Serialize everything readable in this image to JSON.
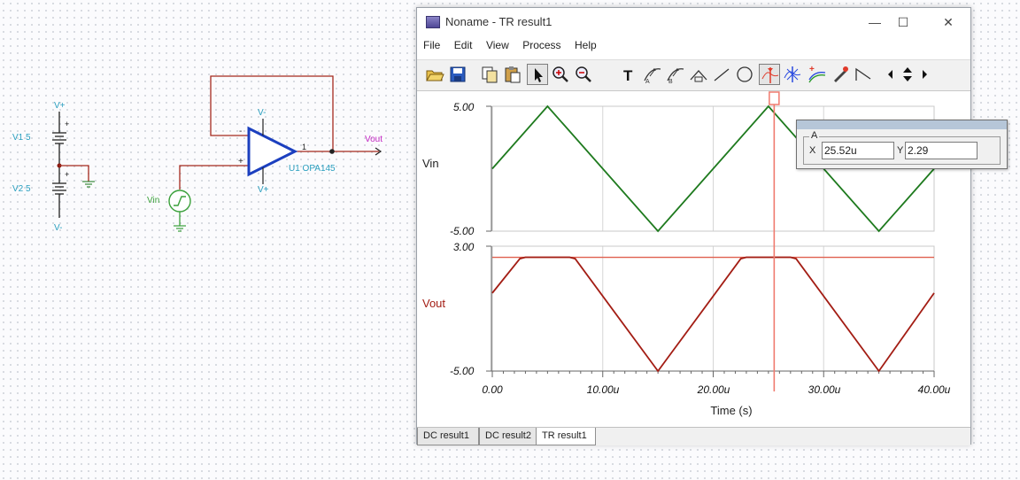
{
  "schematic": {
    "vplus_top": "V+",
    "v1_label": "V1 5",
    "v2_label": "V2 5",
    "vminus_bottom": "V-",
    "opamp_vminus": "V-",
    "opamp_vplus": "V+",
    "opamp_name": "U1 OPA145",
    "pin_neg": "-",
    "pin_pos": "+",
    "pin_out": "1",
    "vin_label": "Vin",
    "vout_label": "Vout"
  },
  "window": {
    "title": "Noname - TR result1",
    "minimize": "—",
    "maximize": "☐",
    "close": "✕"
  },
  "menu": [
    "File",
    "Edit",
    "View",
    "Process",
    "Help"
  ],
  "toolbar": [
    {
      "icon": "open-folder-icon",
      "pressed": false
    },
    {
      "icon": "save-icon",
      "pressed": false
    },
    {
      "icon": "copy-icon",
      "pressed": false
    },
    {
      "icon": "paste-icon",
      "pressed": false
    },
    {
      "icon": "select-arrow-icon",
      "pressed": true
    },
    {
      "icon": "zoom-in-icon",
      "pressed": false
    },
    {
      "icon": "zoom-out-icon",
      "pressed": false
    },
    {
      "icon": "text-tool-icon",
      "pressed": false
    },
    {
      "icon": "curve-marker-icon",
      "pressed": false
    },
    {
      "icon": "curve-marker-2-icon",
      "pressed": false
    },
    {
      "icon": "shape-marker-icon",
      "pressed": false
    },
    {
      "icon": "line-tool-icon",
      "pressed": false
    },
    {
      "icon": "ellipse-tool-icon",
      "pressed": false
    },
    {
      "icon": "cursor-a-icon",
      "pressed": true
    },
    {
      "icon": "cursor-b-icon",
      "pressed": false
    },
    {
      "icon": "add-cursor-icon",
      "pressed": false
    },
    {
      "icon": "pen-marker-icon",
      "pressed": false
    },
    {
      "icon": "step-icon",
      "pressed": false
    },
    {
      "icon": "nav-left-icon",
      "pressed": false
    },
    {
      "icon": "nav-updown-icon",
      "pressed": false
    },
    {
      "icon": "nav-right-icon",
      "pressed": false
    }
  ],
  "cursor_readout": {
    "group": "A",
    "x_label": "X",
    "x_value": "25.52u",
    "y_label": "Y",
    "y_value": "2.29"
  },
  "tabs": [
    {
      "label": "DC result1",
      "active": false
    },
    {
      "label": "DC result2",
      "active": false
    },
    {
      "label": "TR result1",
      "active": true
    }
  ],
  "colors": {
    "vin": "#1e7a1e",
    "vout": "#a31d14",
    "cursor": "#f07a6e",
    "limit": "#e0604f",
    "grid": "#d6d6d6"
  },
  "chart_data": [
    {
      "type": "line",
      "ylabel": "Vin",
      "xlabel": "Time (s)",
      "xlim": [
        0,
        4e-05
      ],
      "ylim": [
        -5,
        5
      ],
      "yticks": [
        "5.00",
        "-5.00"
      ],
      "series": [
        {
          "name": "Vin",
          "x": [
            0,
            5e-06,
            1.5e-05,
            2.5e-05,
            3.5e-05,
            4e-05
          ],
          "y": [
            0,
            5,
            -5,
            5,
            -5,
            0
          ]
        }
      ]
    },
    {
      "type": "line",
      "ylabel": "Vout",
      "xlabel": "Time (s)",
      "xlim": [
        0,
        4e-05
      ],
      "ylim": [
        -5,
        3
      ],
      "yticks": [
        "3.00",
        "-5.00"
      ],
      "xticks": [
        "0.00",
        "10.00u",
        "20.00u",
        "30.00u",
        "40.00u"
      ],
      "series": [
        {
          "name": "Vout",
          "x": [
            0,
            2.5e-06,
            3e-06,
            7e-06,
            7.5e-06,
            1.5e-05,
            2.25e-05,
            2.3e-05,
            2.7e-05,
            2.75e-05,
            3.5e-05,
            4e-05
          ],
          "y": [
            0,
            2.2,
            2.29,
            2.29,
            2.2,
            -5,
            2.2,
            2.29,
            2.29,
            2.2,
            -5,
            0
          ]
        },
        {
          "name": "Limit",
          "x": [
            0,
            4e-05
          ],
          "y": [
            2.29,
            2.29
          ]
        }
      ],
      "cursor_x": 2.552e-05
    }
  ]
}
